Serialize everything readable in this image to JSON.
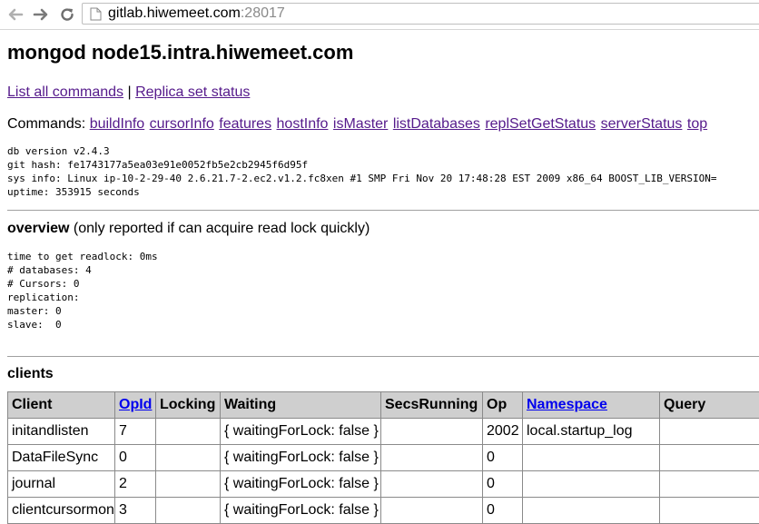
{
  "browser": {
    "url_host": "gitlab.hiwemeet.com",
    "url_port": ":28017"
  },
  "page": {
    "title": "mongod node15.intra.hiwemeet.com",
    "links": {
      "list_all_commands": "List all commands",
      "separator": " | ",
      "replica_set_status": "Replica set status"
    },
    "commands_label": "Commands: ",
    "commands": [
      "buildInfo",
      "cursorInfo",
      "features",
      "hostInfo",
      "isMaster",
      "listDatabases",
      "replSetGetStatus",
      "serverStatus",
      "top"
    ],
    "info_lines": [
      "db version v2.4.3",
      "git hash: fe1743177a5ea03e91e0052fb5e2cb2945f6d95f",
      "sys info: Linux ip-10-2-29-40 2.6.21.7-2.ec2.v1.2.fc8xen #1 SMP Fri Nov 20 17:48:28 EST 2009 x86_64 BOOST_LIB_VERSION=",
      "uptime: 353915 seconds"
    ],
    "overview": {
      "heading": "overview",
      "note": " (only reported if can acquire read lock quickly)",
      "lines": [
        "time to get readlock: 0ms",
        "# databases: 4",
        "# Cursors: 0",
        "replication:",
        "master: 0",
        "slave:  0"
      ]
    },
    "clients": {
      "heading": "clients",
      "columns": [
        "Client",
        "OpId",
        "Locking",
        "Waiting",
        "SecsRunning",
        "Op",
        "Namespace",
        "Query"
      ],
      "rows": [
        [
          "initandlisten",
          "7",
          "",
          "{ waitingForLock: false }",
          "",
          "2002",
          "local.startup_log",
          ""
        ],
        [
          "DataFileSync",
          "0",
          "",
          "{ waitingForLock: false }",
          "",
          "0",
          "",
          ""
        ],
        [
          "journal",
          "2",
          "",
          "{ waitingForLock: false }",
          "",
          "0",
          "",
          ""
        ],
        [
          "clientcursormon",
          "3",
          "",
          "{ waitingForLock: false }",
          "",
          "0",
          "",
          ""
        ]
      ]
    }
  }
}
